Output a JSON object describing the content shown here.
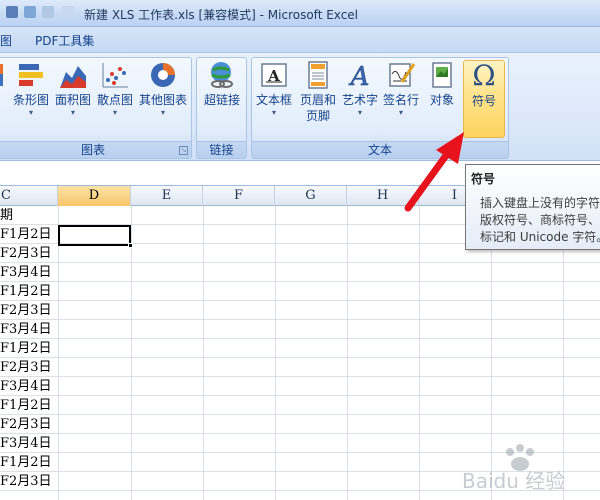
{
  "window": {
    "title": "新建 XLS 工作表.xls  [兼容模式] - Microsoft Excel"
  },
  "tabs": [
    {
      "label": "图"
    },
    {
      "label": "PDF工具集"
    }
  ],
  "ribbon": {
    "groups": [
      {
        "label": "图表",
        "buttons": [
          {
            "label": "条形图",
            "icon": "bar-chart-icon"
          },
          {
            "label": "面积图",
            "icon": "area-chart-icon"
          },
          {
            "label": "散点图",
            "icon": "scatter-chart-icon"
          },
          {
            "label": "其他图表",
            "icon": "other-charts-icon"
          }
        ]
      },
      {
        "label": "链接",
        "buttons": [
          {
            "label": "超链接",
            "icon": "hyperlink-icon"
          }
        ]
      },
      {
        "label": "文本",
        "buttons": [
          {
            "label": "文本框",
            "icon": "textbox-icon"
          },
          {
            "label": "页眉和",
            "label2": "页脚",
            "icon": "header-footer-icon"
          },
          {
            "label": "艺术字",
            "icon": "wordart-icon"
          },
          {
            "label": "签名行",
            "icon": "signature-line-icon"
          },
          {
            "label": "对象",
            "icon": "object-icon"
          },
          {
            "label": "符号",
            "icon": "symbol-omega-icon"
          }
        ]
      }
    ],
    "symbol_glyph": "Ω"
  },
  "grid": {
    "column_headers": [
      "C",
      "D",
      "E",
      "F",
      "G",
      "H",
      "I"
    ],
    "selected_column": "D",
    "column_c_values": [
      "期",
      "F1月2日",
      "F2月3日",
      "F3月4日",
      "F1月2日",
      "F2月3日",
      "F3月4日",
      "F1月2日",
      "F2月3日",
      "F3月4日",
      "F1月2日",
      "F2月3日",
      "F3月4日",
      "F1月2日",
      "F2月3日",
      "F3月4日"
    ]
  },
  "tooltip": {
    "title": "符号",
    "lines": [
      "插入键盘上没有的字符",
      "版权符号、商标符号、I",
      "标记和 Unicode 字符。"
    ]
  },
  "colors": {
    "ribbon_bg": "#dae7f9",
    "active_button": "#ffd45f",
    "arrow": "#e8121d",
    "selected_column_header": "#f8c56a"
  },
  "watermark": {
    "text": "Baidu 经验"
  }
}
